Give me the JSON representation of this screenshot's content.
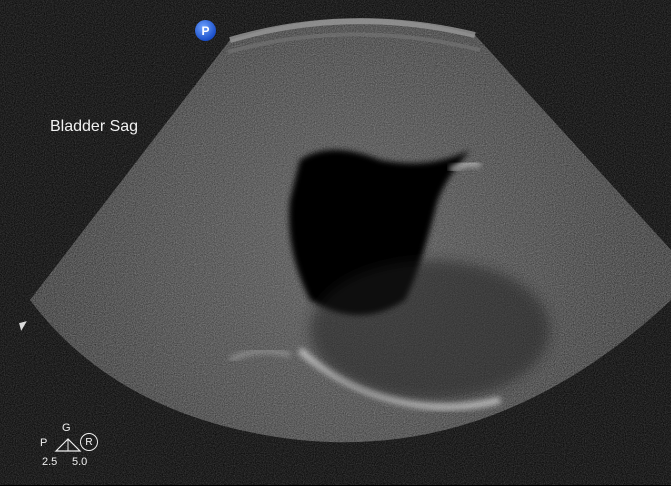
{
  "orientation_marker": "P",
  "image_label": "Bladder Sag",
  "icons": {
    "cursor": "arrow-cursor-icon",
    "gain_indicator": "triangle-icon"
  },
  "settings": {
    "left_letter": "P",
    "gain_letter": "G",
    "right_letter": "R",
    "value_left": "2.5",
    "value_right": "5.0"
  }
}
